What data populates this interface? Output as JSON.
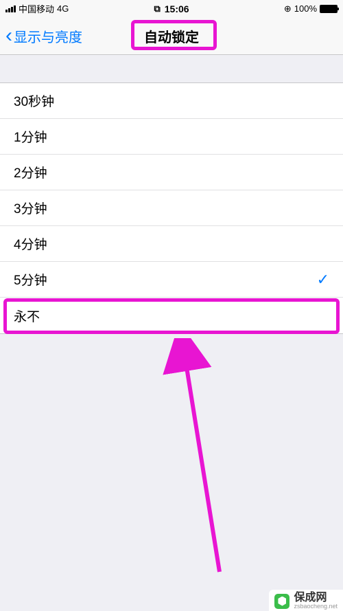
{
  "statusBar": {
    "carrier": "中国移动",
    "network": "4G",
    "time": "15:06",
    "battery": "100%"
  },
  "navBar": {
    "backLabel": "显示与亮度",
    "title": "自动锁定"
  },
  "options": [
    {
      "label": "30秒钟",
      "selected": false
    },
    {
      "label": "1分钟",
      "selected": false
    },
    {
      "label": "2分钟",
      "selected": false
    },
    {
      "label": "3分钟",
      "selected": false
    },
    {
      "label": "4分钟",
      "selected": false
    },
    {
      "label": "5分钟",
      "selected": true
    },
    {
      "label": "永不",
      "selected": false
    }
  ],
  "watermark": {
    "main": "保成网",
    "sub": "zsbaocheng.net"
  }
}
